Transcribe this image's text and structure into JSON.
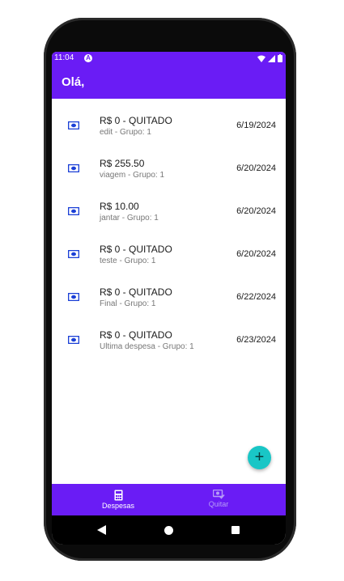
{
  "status_bar": {
    "time": "11:04",
    "notification_icon": "A"
  },
  "app_bar": {
    "title": "Olá,"
  },
  "expenses": [
    {
      "amount": "R$ 0 - QUITADO",
      "description": "edit - Grupo: 1",
      "date": "6/19/2024",
      "icon": "money-icon"
    },
    {
      "amount": "R$ 255.50",
      "description": "viagem - Grupo: 1",
      "date": "6/20/2024",
      "icon": "money-icon"
    },
    {
      "amount": "R$ 10.00",
      "description": "jantar - Grupo: 1",
      "date": "6/20/2024",
      "icon": "money-icon"
    },
    {
      "amount": "R$ 0 - QUITADO",
      "description": "teste - Grupo: 1",
      "date": "6/20/2024",
      "icon": "money-icon"
    },
    {
      "amount": "R$ 0 - QUITADO",
      "description": "Final - Grupo: 1",
      "date": "6/22/2024",
      "icon": "money-icon"
    },
    {
      "amount": "R$ 0 - QUITADO",
      "description": "Ultima despesa - Grupo: 1",
      "date": "6/23/2024",
      "icon": "money-icon"
    }
  ],
  "fab": {
    "label": "+"
  },
  "bottom_nav": {
    "items": [
      {
        "label": "Despesas",
        "icon": "calculator-icon",
        "active": true
      },
      {
        "label": "Quitar",
        "icon": "money-check-icon",
        "active": false
      }
    ]
  },
  "colors": {
    "primary": "#6a1cf5",
    "accent": "#19c6c6",
    "icon_blue": "#1a3fd6"
  }
}
